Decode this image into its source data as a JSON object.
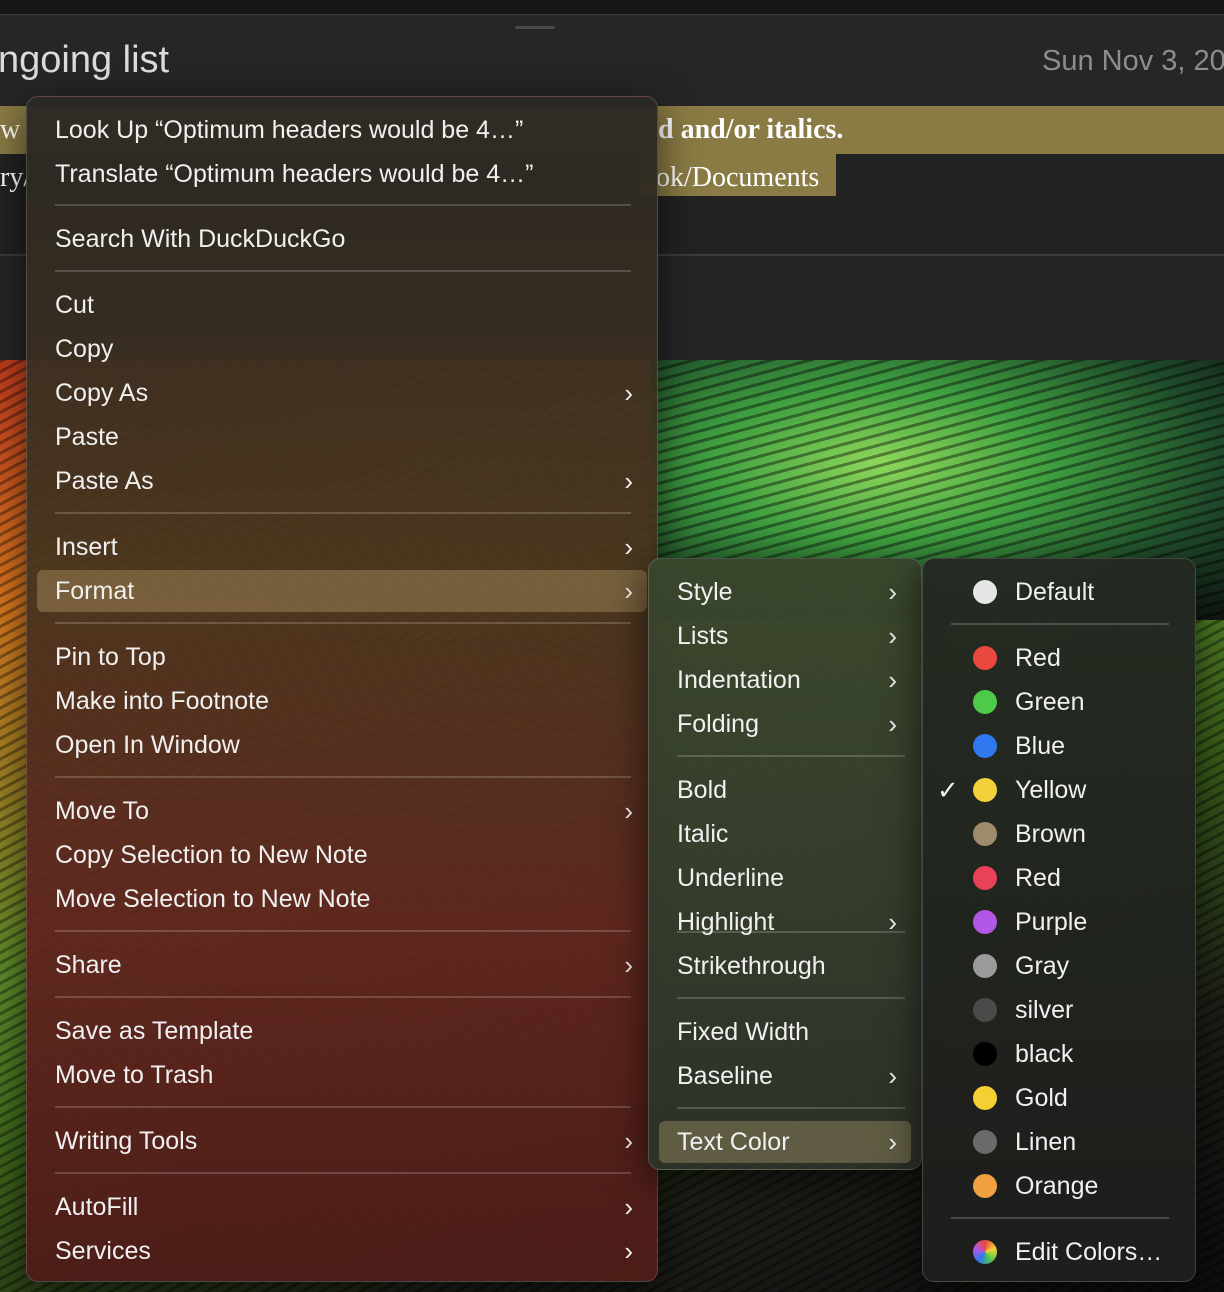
{
  "note": {
    "title": "ngoing list",
    "date": "Sun Nov 3, 20",
    "line1_text": "d and/or italics.",
    "line1_left": "w",
    "line2_text": "ok/Documents",
    "line2_left": "ry/"
  },
  "main_menu": {
    "items": [
      {
        "label": "Look Up “Optimum headers would be 4…”"
      },
      {
        "label": "Translate “Optimum headers would be 4…”"
      },
      {
        "label": "Search With DuckDuckGo"
      },
      {
        "label": "Cut"
      },
      {
        "label": "Copy"
      },
      {
        "label": "Copy As",
        "submenu": true
      },
      {
        "label": "Paste"
      },
      {
        "label": "Paste As",
        "submenu": true
      },
      {
        "label": "Insert",
        "submenu": true
      },
      {
        "label": "Format",
        "submenu": true,
        "selected": true
      },
      {
        "label": "Pin to Top"
      },
      {
        "label": "Make into Footnote"
      },
      {
        "label": "Open In Window"
      },
      {
        "label": "Move To",
        "submenu": true
      },
      {
        "label": "Copy Selection to New Note"
      },
      {
        "label": "Move Selection to New Note"
      },
      {
        "label": "Share",
        "submenu": true
      },
      {
        "label": "Save as Template"
      },
      {
        "label": "Move to Trash"
      },
      {
        "label": "Writing Tools",
        "submenu": true
      },
      {
        "label": "AutoFill",
        "submenu": true
      },
      {
        "label": "Services",
        "submenu": true
      }
    ]
  },
  "format_menu": {
    "items": [
      {
        "label": "Style",
        "submenu": true
      },
      {
        "label": "Lists",
        "submenu": true
      },
      {
        "label": "Indentation",
        "submenu": true
      },
      {
        "label": "Folding",
        "submenu": true
      },
      {
        "label": "Bold"
      },
      {
        "label": "Italic"
      },
      {
        "label": "Underline"
      },
      {
        "label": "Highlight",
        "submenu": true
      },
      {
        "label": "Strikethrough"
      },
      {
        "label": "Fixed Width"
      },
      {
        "label": "Baseline",
        "submenu": true
      },
      {
        "label": "Text Color",
        "submenu": true,
        "selected": true
      }
    ]
  },
  "color_menu": {
    "checkmark": "✓",
    "items": [
      {
        "label": "Default",
        "color": "#e6e6e6"
      },
      {
        "label": "Red",
        "color": "#e8483d"
      },
      {
        "label": "Green",
        "color": "#4ec94a"
      },
      {
        "label": "Blue",
        "color": "#2f78f0"
      },
      {
        "label": "Yellow",
        "color": "#f2d23a",
        "checked": true
      },
      {
        "label": "Brown",
        "color": "#a08a6c"
      },
      {
        "label": "Red",
        "color": "#e8425a"
      },
      {
        "label": "Purple",
        "color": "#b156e6"
      },
      {
        "label": "Gray",
        "color": "#9a9a9a"
      },
      {
        "label": "silver",
        "color": "#4a4a48"
      },
      {
        "label": "black",
        "color": "#000000"
      },
      {
        "label": "Gold",
        "color": "#f4d035"
      },
      {
        "label": "Linen",
        "color": "#6a6a6a"
      },
      {
        "label": "Orange",
        "color": "#f0a040"
      },
      {
        "label": "Edit Colors…",
        "icon": "color-wheel-icon"
      }
    ]
  }
}
